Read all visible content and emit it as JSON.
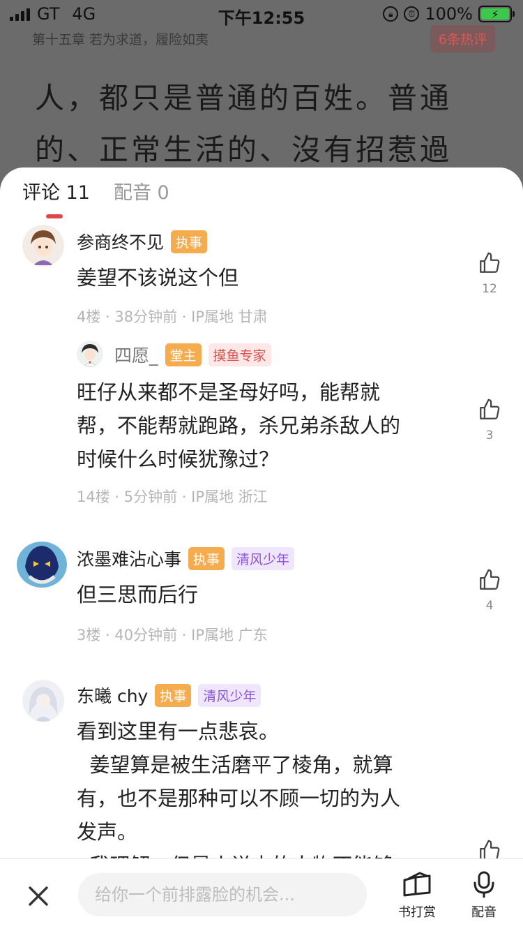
{
  "status_bar": {
    "carrier": "GT",
    "network": "4G",
    "time": "下午12:55",
    "battery": "100%"
  },
  "reader": {
    "chapter_title": "第十五章 若为求道，履险如夷",
    "hot_comments": "6条热评",
    "text_line1": "人，都只是普通的百姓。普通",
    "text_line2": "的、正常生活的、沒有招惹過任"
  },
  "tabs": [
    {
      "label": "评论 11"
    },
    {
      "label": "配音 0"
    }
  ],
  "comments": [
    {
      "author": "参商终不见",
      "badges": [
        "执事"
      ],
      "text": "姜望不该说这个但",
      "meta": "4楼 · 38分钟前 · IP属地 甘肃",
      "likes": "12"
    },
    {
      "author": "四愿_",
      "badges": [
        "堂主",
        "摸鱼专家"
      ],
      "text": "旺仔从来都不是圣母好吗，能帮就\n帮，不能帮就跑路，杀兄弟杀敌人的\n时候什么时候犹豫过？",
      "meta": "14楼 · 5分钟前 · IP属地 浙江",
      "likes": "3"
    },
    {
      "author": "浓墨难沾心事",
      "badges": [
        "执事",
        "清风少年"
      ],
      "text": "但三思而后行",
      "meta": "3楼 · 40分钟前 · IP属地 广东",
      "likes": "4"
    },
    {
      "author": "东曦 chy",
      "badges": [
        "执事",
        "清风少年"
      ],
      "text": "看到这里有一点悲哀。\n  姜望算是被生活磨平了棱角，就算\n有，也不是那种可以不顾一切的为人\n发声。\n  我理解，但是小说中的人物不能够",
      "meta": "",
      "likes": ""
    }
  ],
  "bottom_bar": {
    "input_placeholder": "给你一个前排露脸的机会...",
    "reward_label": "书打赏",
    "dub_label": "配音"
  },
  "colors": {
    "accent_red": "#e14747",
    "badge_orange": "#f5ac4e",
    "badge_purple_text": "#8a54d4",
    "badge_pink_text": "#d9534f"
  }
}
